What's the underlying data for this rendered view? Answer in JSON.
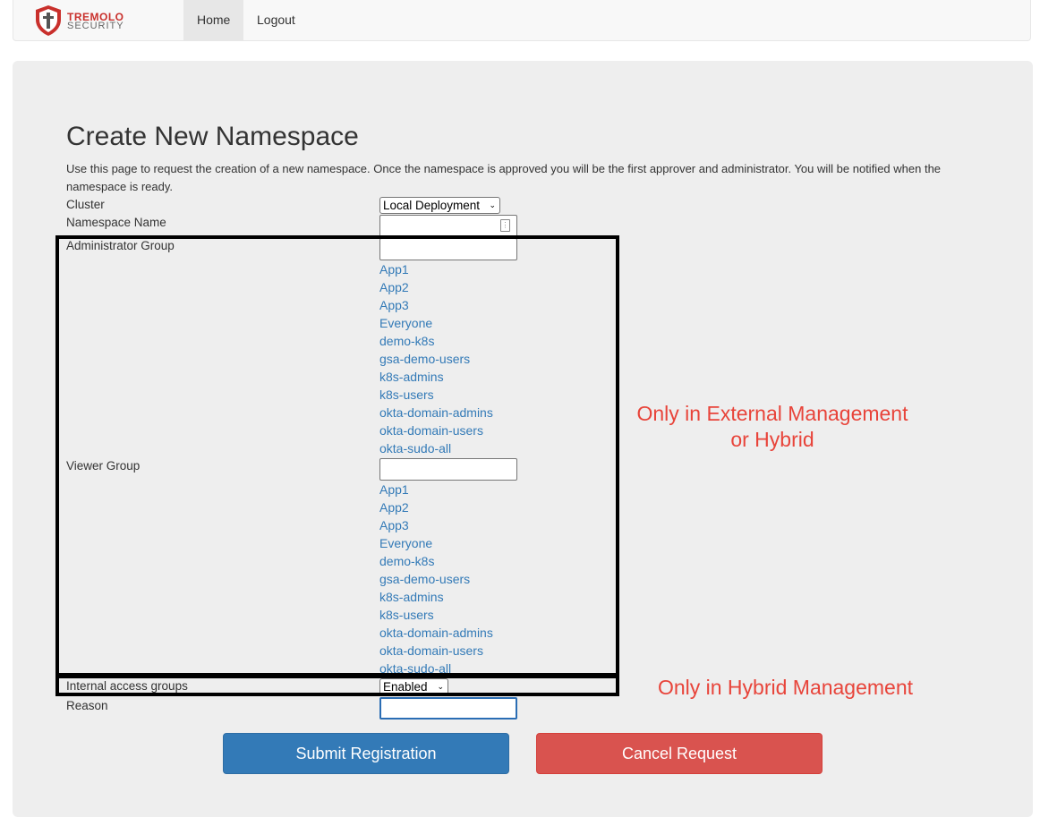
{
  "nav": {
    "logo_line1": "TREMOLO",
    "logo_line2": "SECURITY",
    "home": "Home",
    "logout": "Logout"
  },
  "page": {
    "title": "Create New Namespace",
    "intro": "Use this page to request the creation of a new namespace. Once the namespace is approved you will be the first approver and administrator. You will be notified when the namespace is ready."
  },
  "form": {
    "cluster_label": "Cluster",
    "cluster_value": "Local Deployment",
    "namespace_label": "Namespace Name",
    "namespace_value": "",
    "admin_group_label": "Administrator Group",
    "admin_group_value": "",
    "admin_groups": [
      "App1",
      "App2",
      "App3",
      "Everyone",
      "demo-k8s",
      "gsa-demo-users",
      "k8s-admins",
      "k8s-users",
      "okta-domain-admins",
      "okta-domain-users",
      "okta-sudo-all"
    ],
    "viewer_group_label": "Viewer Group",
    "viewer_group_value": "",
    "viewer_groups": [
      "App1",
      "App2",
      "App3",
      "Everyone",
      "demo-k8s",
      "gsa-demo-users",
      "k8s-admins",
      "k8s-users",
      "okta-domain-admins",
      "okta-domain-users",
      "okta-sudo-all"
    ],
    "internal_access_label": "Internal access groups",
    "internal_access_value": "Enabled",
    "reason_label": "Reason",
    "reason_value": ""
  },
  "annotations": {
    "external_line1": "Only in External Management",
    "external_line2": "or Hybrid",
    "hybrid": "Only in Hybrid Management"
  },
  "buttons": {
    "submit": "Submit Registration",
    "cancel": "Cancel Request"
  },
  "colors": {
    "primary": "#337ab7",
    "danger": "#d9534f",
    "link": "#337ab7",
    "annotation": "#e8443a"
  }
}
